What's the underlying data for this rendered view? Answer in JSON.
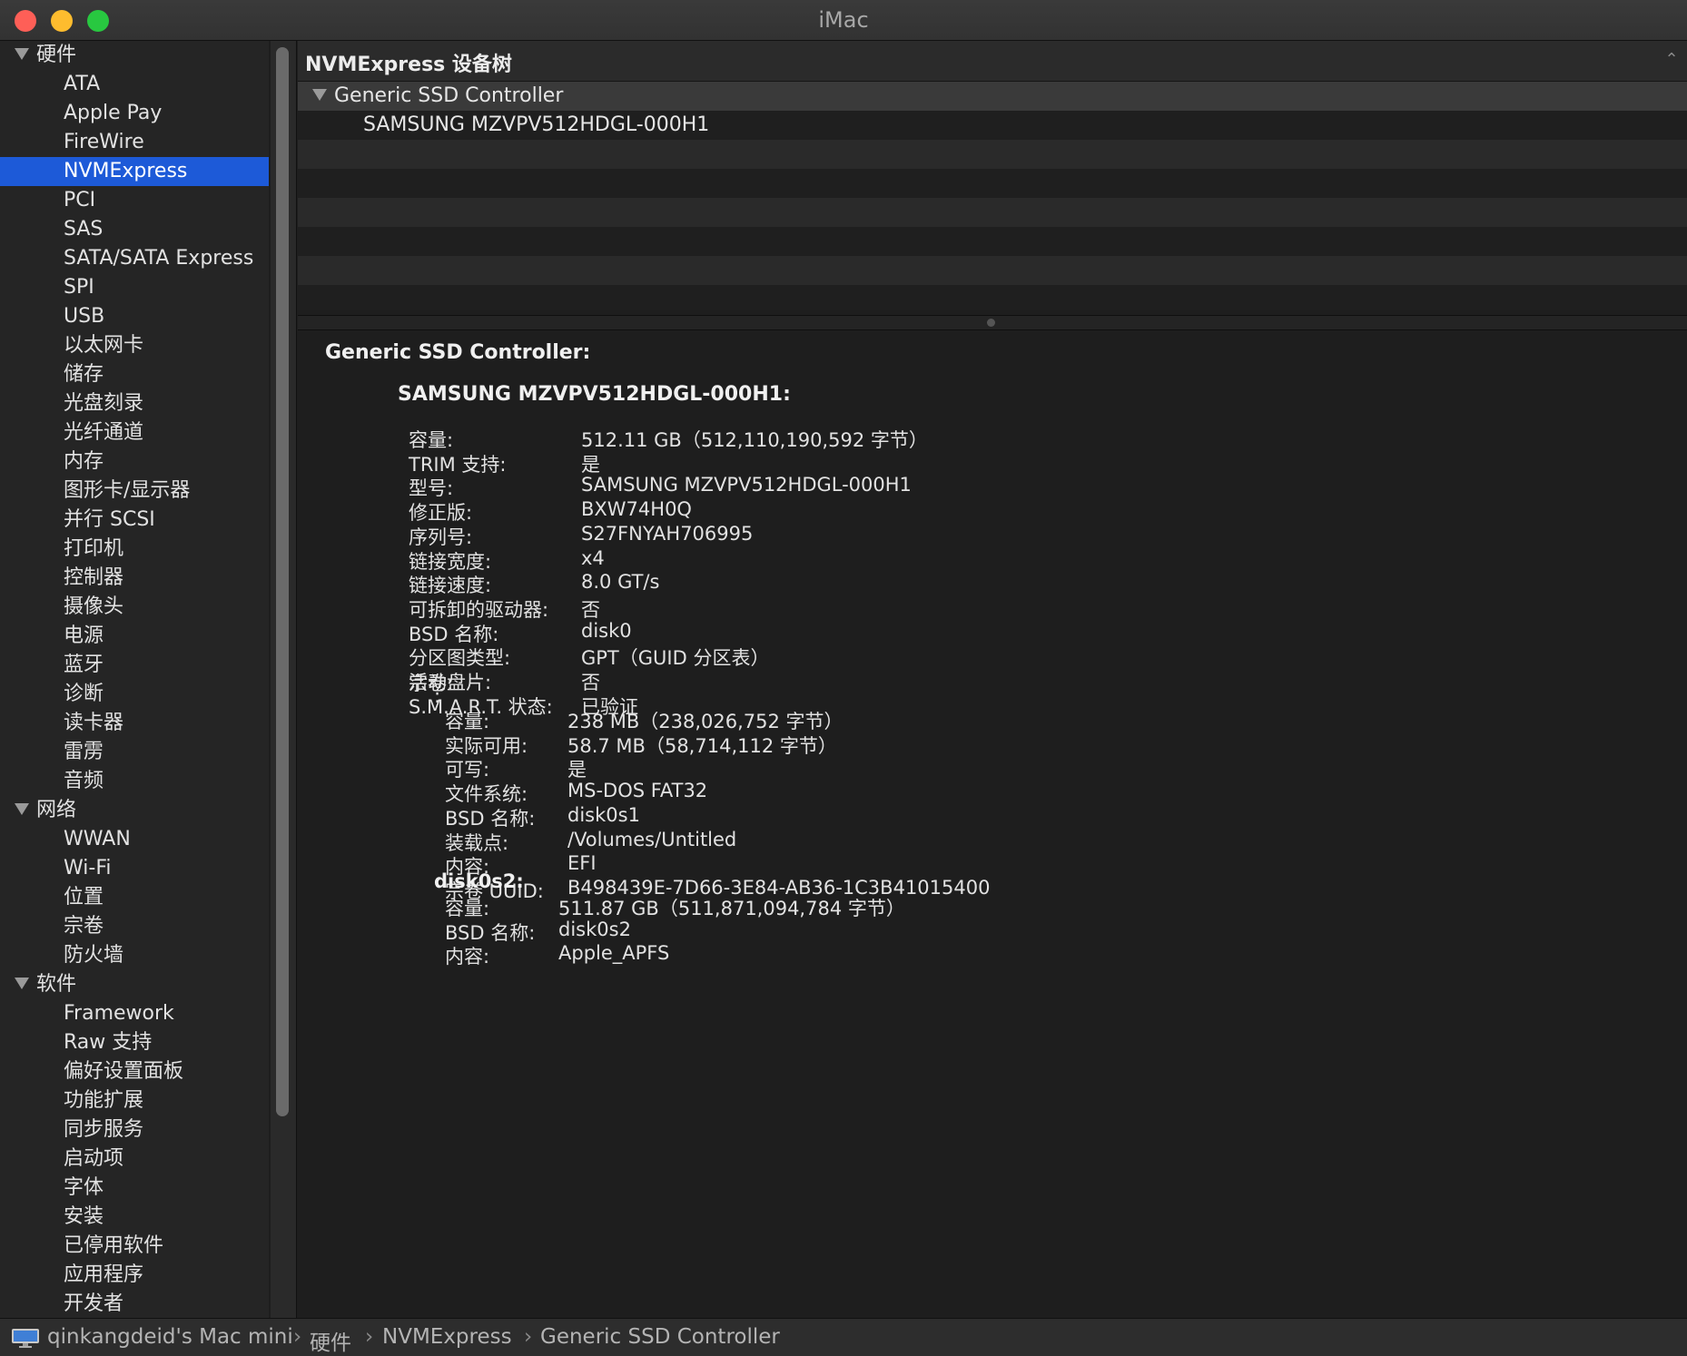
{
  "window": {
    "title": "iMac"
  },
  "sidebar": {
    "hardware_header": "硬件",
    "hardware_items": [
      "ATA",
      "Apple Pay",
      "FireWire",
      "NVMExpress",
      "PCI",
      "SAS",
      "SATA/SATA Express",
      "SPI",
      "USB",
      "以太网卡",
      "储存",
      "光盘刻录",
      "光纤通道",
      "内存",
      "图形卡/显示器",
      "并行 SCSI",
      "打印机",
      "控制器",
      "摄像头",
      "电源",
      "蓝牙",
      "诊断",
      "读卡器",
      "雷雳",
      "音频"
    ],
    "network_header": "网络",
    "network_items": [
      "WWAN",
      "Wi-Fi",
      "位置",
      "宗卷",
      "防火墙"
    ],
    "software_header": "软件",
    "software_items": [
      "Framework",
      "Raw 支持",
      "偏好设置面板",
      "功能扩展",
      "同步服务",
      "启动项",
      "字体",
      "安装",
      "已停用软件",
      "应用程序",
      "开发者"
    ],
    "selected": "NVMExpress"
  },
  "tree": {
    "title": "NVMExpress 设备树",
    "controller": "Generic SSD Controller",
    "device": "SAMSUNG MZVPV512HDGL-000H1"
  },
  "detail": {
    "controller_title": "Generic SSD Controller:",
    "device_title": "SAMSUNG MZVPV512HDGL-000H1:",
    "device_fields": [
      {
        "k": "容量:",
        "v": "512.11 GB（512,110,190,592 字节）"
      },
      {
        "k": "TRIM 支持:",
        "v": "是"
      },
      {
        "k": "型号:",
        "v": "SAMSUNG MZVPV512HDGL-000H1"
      },
      {
        "k": "修正版:",
        "v": "BXW74H0Q"
      },
      {
        "k": "序列号:",
        "v": "S27FNYAH706995"
      },
      {
        "k": "链接宽度:",
        "v": "x4"
      },
      {
        "k": "链接速度:",
        "v": "8.0 GT/s"
      },
      {
        "k": "可拆卸的驱动器:",
        "v": "否"
      },
      {
        "k": "BSD 名称:",
        "v": "disk0"
      },
      {
        "k": "分区图类型:",
        "v": "GPT（GUID 分区表）"
      },
      {
        "k": "活动盘片:",
        "v": "否"
      },
      {
        "k": "S.M.A.R.T. 状态:",
        "v": "已验证"
      }
    ],
    "volumes_label": "宗卷:",
    "volume_blank_name": ":",
    "volume1_fields": [
      {
        "k": "容量:",
        "v": "238 MB（238,026,752 字节）"
      },
      {
        "k": "实际可用:",
        "v": "58.7 MB（58,714,112 字节）"
      },
      {
        "k": "可写:",
        "v": "是"
      },
      {
        "k": "文件系统:",
        "v": "MS-DOS FAT32"
      },
      {
        "k": "BSD 名称:",
        "v": "disk0s1"
      },
      {
        "k": "装载点:",
        "v": "/Volumes/Untitled"
      },
      {
        "k": "内容:",
        "v": "EFI"
      },
      {
        "k": "宗卷 UUID:",
        "v": "B498439E-7D66-3E84-AB36-1C3B41015400"
      }
    ],
    "volume2_name": "disk0s2:",
    "volume2_fields": [
      {
        "k": "容量:",
        "v": "511.87 GB（511,871,094,784 字节）"
      },
      {
        "k": "BSD 名称:",
        "v": "disk0s2"
      },
      {
        "k": "内容:",
        "v": "Apple_APFS"
      }
    ]
  },
  "statusbar": {
    "icon": "imac-icon",
    "path": [
      "qinkangdeid's Mac mini",
      "硬件",
      "NVMExpress",
      "Generic SSD Controller"
    ],
    "separator": "›"
  }
}
